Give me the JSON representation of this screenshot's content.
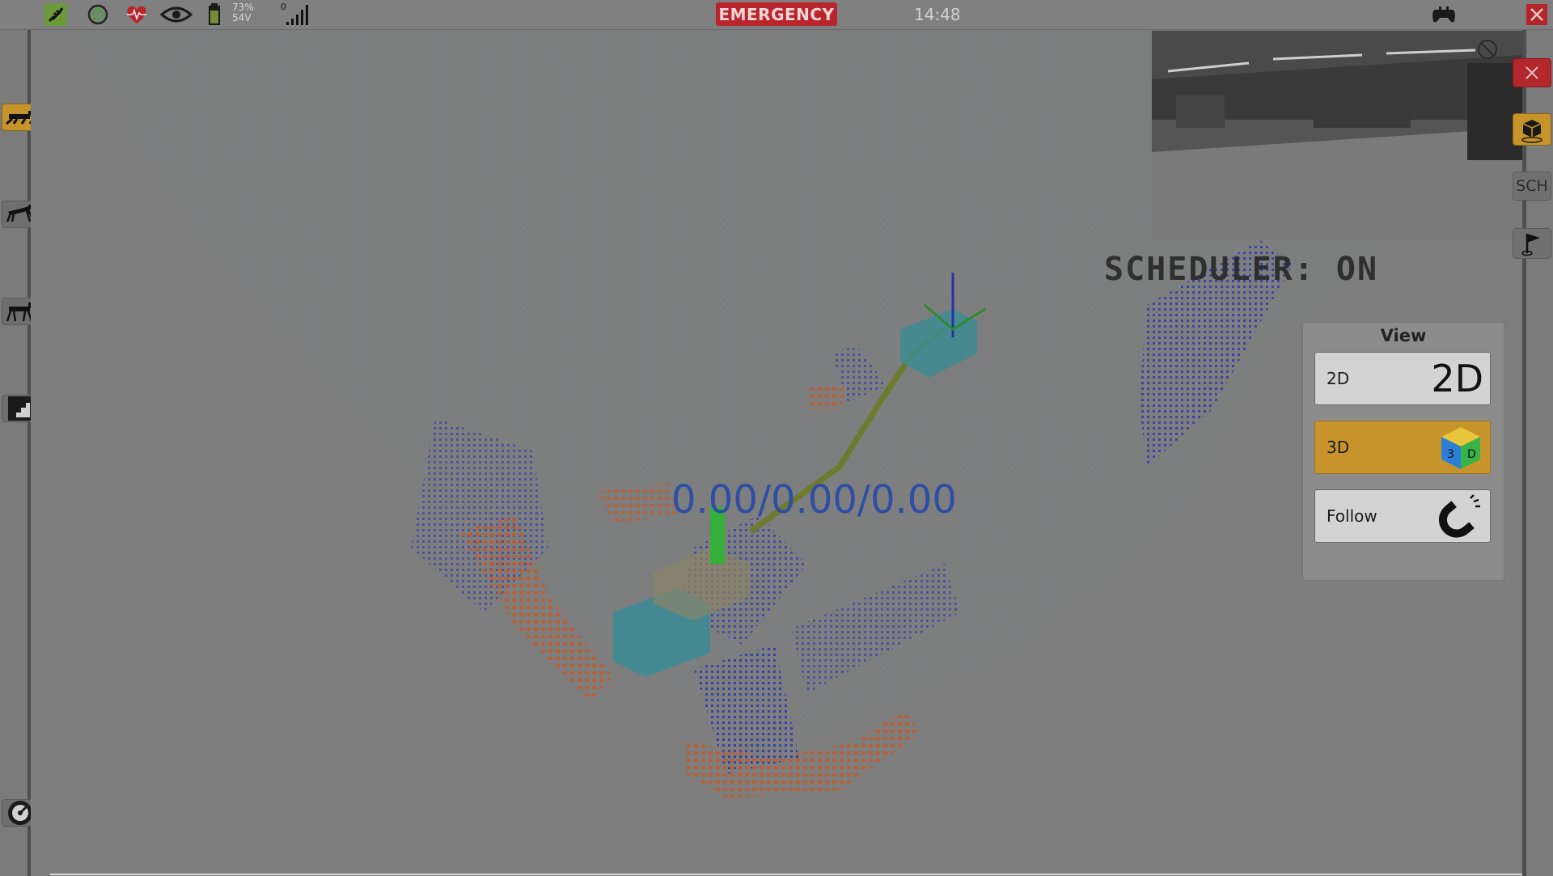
{
  "topbar": {
    "battery_percent": "73%",
    "battery_voltage": "54V",
    "signal_count": "0",
    "emergency_label": "EMERGENCY",
    "clock": "14:48",
    "icons": [
      "plug-icon",
      "power-icon",
      "heartbeat-icon",
      "eye-icon",
      "battery-icon",
      "signal-icon",
      "gamepad-icon",
      "close-icon"
    ]
  },
  "left_sidebar": {
    "items": [
      {
        "name": "robot-lying-mode",
        "active": true
      },
      {
        "name": "robot-sit-mode",
        "active": false
      },
      {
        "name": "robot-stand-mode",
        "active": false
      },
      {
        "name": "stairs-mode",
        "active": false
      },
      {
        "name": "speed-gauge",
        "active": false
      }
    ]
  },
  "right_sidebar": {
    "items": [
      {
        "name": "close-panel",
        "active": false
      },
      {
        "name": "3d-box-tool",
        "active": true
      },
      {
        "name": "scheduler-toggle",
        "label": "SCH"
      },
      {
        "name": "flag-waypoint",
        "active": false
      }
    ]
  },
  "map": {
    "scheduler_status": "SCHEDULER: ON",
    "coordinates": "0.00/0.00/0.00"
  },
  "view_panel": {
    "title": "View",
    "buttons": [
      {
        "label": "2D",
        "icon_text": "2D",
        "active": false
      },
      {
        "label": "3D",
        "icon_text": "3D",
        "active": true
      },
      {
        "label": "Follow",
        "icon": "magnet-icon",
        "active": false
      }
    ]
  },
  "colors": {
    "accent": "#c6942a",
    "emergency": "#b8262c",
    "topbar": "#808080",
    "coords_text": "#2d4ea3"
  }
}
